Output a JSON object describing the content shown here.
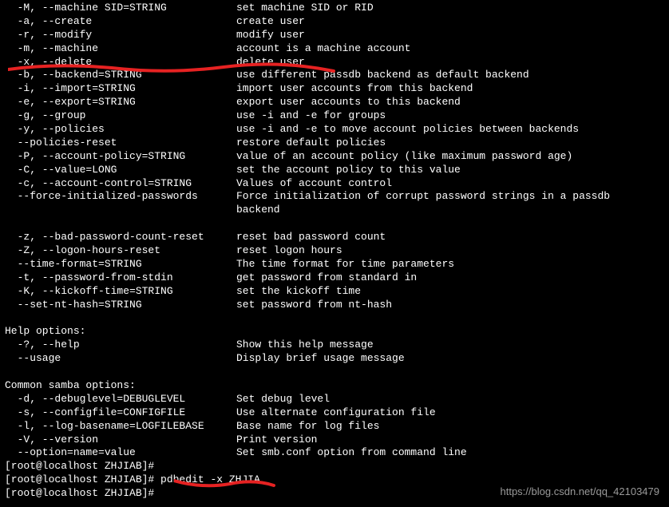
{
  "options": [
    {
      "opt": "  -M, --machine SID=STRING",
      "desc": "set machine SID or RID"
    },
    {
      "opt": "  -a, --create",
      "desc": "create user"
    },
    {
      "opt": "  -r, --modify",
      "desc": "modify user"
    },
    {
      "opt": "  -m, --machine",
      "desc": "account is a machine account"
    },
    {
      "opt": "  -x, --delete",
      "desc": "delete user"
    },
    {
      "opt": "  -b, --backend=STRING",
      "desc": "use different passdb backend as default backend"
    },
    {
      "opt": "  -i, --import=STRING",
      "desc": "import user accounts from this backend"
    },
    {
      "opt": "  -e, --export=STRING",
      "desc": "export user accounts to this backend"
    },
    {
      "opt": "  -g, --group",
      "desc": "use -i and -e for groups"
    },
    {
      "opt": "  -y, --policies",
      "desc": "use -i and -e to move account policies between backends"
    },
    {
      "opt": "  --policies-reset",
      "desc": "restore default policies"
    },
    {
      "opt": "  -P, --account-policy=STRING",
      "desc": "value of an account policy (like maximum password age)"
    },
    {
      "opt": "  -C, --value=LONG",
      "desc": "set the account policy to this value"
    },
    {
      "opt": "  -c, --account-control=STRING",
      "desc": "Values of account control"
    },
    {
      "opt": "  --force-initialized-passwords",
      "desc": "Force initialization of corrupt password strings in a passdb"
    },
    {
      "opt": "",
      "desc": "backend"
    },
    {
      "opt": "",
      "desc": ""
    },
    {
      "opt": "  -z, --bad-password-count-reset",
      "desc": "reset bad password count"
    },
    {
      "opt": "  -Z, --logon-hours-reset",
      "desc": "reset logon hours"
    },
    {
      "opt": "  --time-format=STRING",
      "desc": "The time format for time parameters"
    },
    {
      "opt": "  -t, --password-from-stdin",
      "desc": "get password from standard in"
    },
    {
      "opt": "  -K, --kickoff-time=STRING",
      "desc": "set the kickoff time"
    },
    {
      "opt": "  --set-nt-hash=STRING",
      "desc": "set password from nt-hash"
    }
  ],
  "help_header": "Help options:",
  "help_options": [
    {
      "opt": "  -?, --help",
      "desc": "Show this help message"
    },
    {
      "opt": "  --usage",
      "desc": "Display brief usage message"
    }
  ],
  "common_header": "Common samba options:",
  "common_options": [
    {
      "opt": "  -d, --debuglevel=DEBUGLEVEL",
      "desc": "Set debug level"
    },
    {
      "opt": "  -s, --configfile=CONFIGFILE",
      "desc": "Use alternate configuration file"
    },
    {
      "opt": "  -l, --log-basename=LOGFILEBASE",
      "desc": "Base name for log files"
    },
    {
      "opt": "  -V, --version",
      "desc": "Print version"
    },
    {
      "opt": "  --option=name=value",
      "desc": "Set smb.conf option from command line"
    }
  ],
  "prompts": [
    "[root@localhost ZHJIAB]#",
    "[root@localhost ZHJIAB]# pdbedit -x ZHJIA",
    "[root@localhost ZHJIAB]#"
  ],
  "watermark": "https://blog.csdn.net/qq_42103479"
}
